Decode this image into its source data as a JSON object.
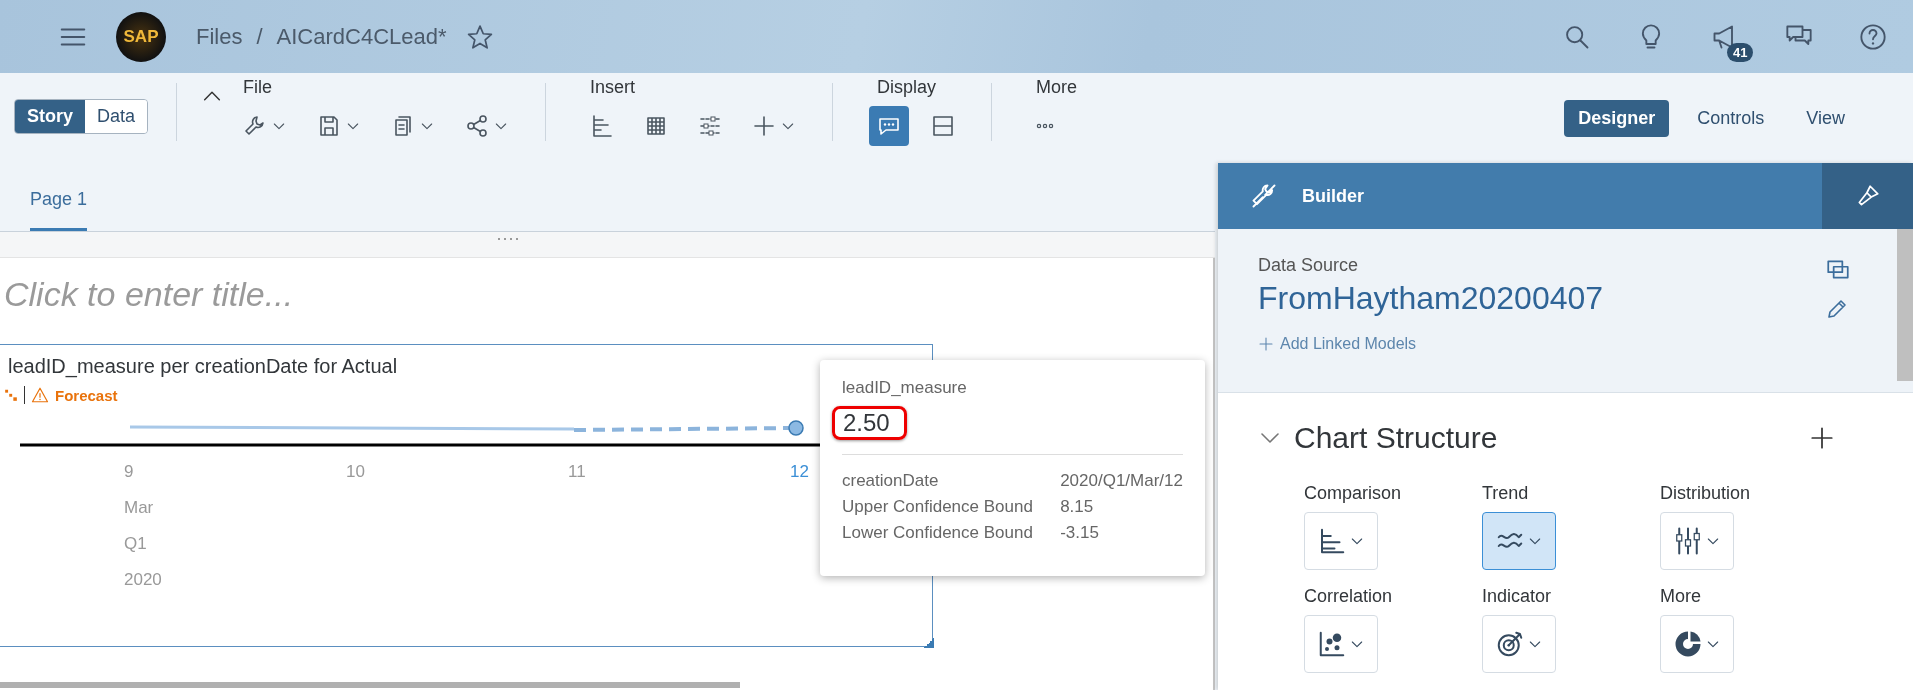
{
  "shell": {
    "logo": "SAP",
    "breadcrumb": [
      "Files",
      "AICardC4CLead*"
    ],
    "separator": "/",
    "favorite": false,
    "notification_count": "41"
  },
  "toolbar": {
    "modes": [
      {
        "label": "Story",
        "selected": true
      },
      {
        "label": "Data",
        "selected": false
      }
    ],
    "groups": [
      {
        "title": "File",
        "buttons": [
          {
            "kind": "wrench",
            "menu": true,
            "selected": false
          },
          {
            "kind": "save",
            "menu": true,
            "selected": false
          },
          {
            "kind": "copy",
            "menu": true,
            "selected": false
          },
          {
            "kind": "share",
            "menu": true,
            "selected": false
          }
        ]
      },
      {
        "title": "Insert",
        "buttons": [
          {
            "kind": "barchart",
            "menu": false,
            "selected": false
          },
          {
            "kind": "table",
            "menu": false,
            "selected": false
          },
          {
            "kind": "sliders",
            "menu": false,
            "selected": false
          },
          {
            "kind": "plus",
            "menu": true,
            "selected": false
          }
        ]
      },
      {
        "title": "Display",
        "buttons": [
          {
            "kind": "comment",
            "menu": false,
            "selected": true
          },
          {
            "kind": "layout",
            "menu": false,
            "selected": false
          }
        ]
      },
      {
        "title": "More",
        "buttons": [
          {
            "kind": "more",
            "menu": false,
            "selected": false
          }
        ]
      }
    ],
    "views": [
      {
        "label": "Designer",
        "selected": true
      },
      {
        "label": "Controls",
        "selected": false
      },
      {
        "label": "View",
        "selected": false
      }
    ]
  },
  "pages": [
    {
      "label": "Page 1",
      "selected": true
    }
  ],
  "canvas": {
    "title_placeholder": "Click to enter title...",
    "chart": {
      "title": "leadID_measure per creationDate for Actual",
      "status": "Forecast",
      "x_labels": [
        {
          "label": "9",
          "selected": false
        },
        {
          "label": "10",
          "selected": false
        },
        {
          "label": "11",
          "selected": false
        },
        {
          "label": "12",
          "selected": true
        }
      ],
      "levels": [
        "Mar",
        "Q1",
        "2020"
      ]
    },
    "tooltip": {
      "measure": "leadID_measure",
      "value": "2.50",
      "rows": [
        {
          "label": "creationDate",
          "value": "2020/Q1/Mar/12"
        },
        {
          "label": "Upper Confidence Bound",
          "value": "8.15"
        },
        {
          "label": "Lower Confidence Bound",
          "value": "-3.15"
        }
      ]
    }
  },
  "builder": {
    "title": "Builder",
    "data_source_label": "Data Source",
    "data_source": "FromHaytham20200407",
    "add_models": "Add Linked Models",
    "section": "Chart Structure",
    "section_expanded": true,
    "chart_types": [
      {
        "label": "Comparison",
        "kind": "comparison",
        "selected": false
      },
      {
        "label": "Trend",
        "kind": "trend",
        "selected": true
      },
      {
        "label": "Distribution",
        "kind": "distribution",
        "selected": false
      },
      {
        "label": "Correlation",
        "kind": "correlation",
        "selected": false
      },
      {
        "label": "Indicator",
        "kind": "indicator",
        "selected": false
      },
      {
        "label": "More",
        "kind": "donut",
        "selected": false
      }
    ]
  }
}
